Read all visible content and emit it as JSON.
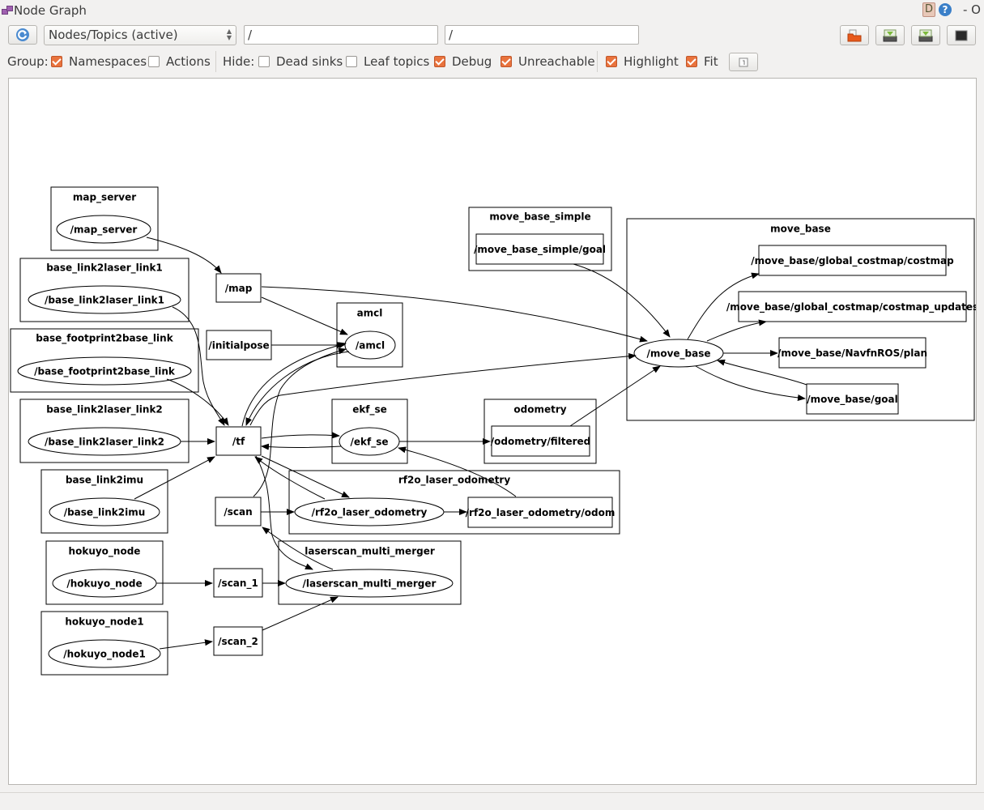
{
  "window": {
    "title": "Node Graph",
    "right_text": "- O",
    "d_label": "D",
    "help_label": "?"
  },
  "toolbar": {
    "refresh_icon": "refresh-icon",
    "graph_type": "Nodes/Topics (active)",
    "node_filter": "/",
    "topic_filter": "/",
    "right_buttons": [
      "open-icon",
      "save-dot-icon",
      "save-image-icon",
      "screenshot-icon"
    ]
  },
  "options": {
    "group_label": "Group:",
    "hide_label": "Hide:",
    "checkboxes": [
      {
        "label": "Namespaces",
        "checked": true
      },
      {
        "label": "Actions",
        "checked": false
      },
      {
        "label": "Dead sinks",
        "checked": false
      },
      {
        "label": "Leaf topics",
        "checked": false
      },
      {
        "label": "Debug",
        "checked": true
      },
      {
        "label": "Unreachable",
        "checked": true
      },
      {
        "label": "Highlight",
        "checked": true
      },
      {
        "label": "Fit",
        "checked": true
      }
    ],
    "fit_button_icon": "fit-view-icon"
  },
  "graph": {
    "clusters": [
      {
        "id": "c_map_server",
        "label": "map_server"
      },
      {
        "id": "c_bl2ll1",
        "label": "base_link2laser_link1"
      },
      {
        "id": "c_bf2bl",
        "label": "base_footprint2base_link"
      },
      {
        "id": "c_bl2ll2",
        "label": "base_link2laser_link2"
      },
      {
        "id": "c_bl2imu",
        "label": "base_link2imu"
      },
      {
        "id": "c_hokuyo",
        "label": "hokuyo_node"
      },
      {
        "id": "c_hokuyo1",
        "label": "hokuyo_node1"
      },
      {
        "id": "c_amcl",
        "label": "amcl"
      },
      {
        "id": "c_ekf",
        "label": "ekf_se"
      },
      {
        "id": "c_odometry",
        "label": "odometry"
      },
      {
        "id": "c_rf2o",
        "label": "rf2o_laser_odometry"
      },
      {
        "id": "c_lsmm",
        "label": "laserscan_multi_merger"
      },
      {
        "id": "c_mbs",
        "label": "move_base_simple"
      },
      {
        "id": "c_mb",
        "label": "move_base"
      }
    ],
    "nodes": [
      {
        "id": "n_map_server",
        "label": "/map_server",
        "kind": "node"
      },
      {
        "id": "n_bl2ll1",
        "label": "/base_link2laser_link1",
        "kind": "node"
      },
      {
        "id": "n_bf2bl",
        "label": "/base_footprint2base_link",
        "kind": "node"
      },
      {
        "id": "n_bl2ll2",
        "label": "/base_link2laser_link2",
        "kind": "node"
      },
      {
        "id": "n_bl2imu",
        "label": "/base_link2imu",
        "kind": "node"
      },
      {
        "id": "n_hokuyo",
        "label": "/hokuyo_node",
        "kind": "node"
      },
      {
        "id": "n_hokuyo1",
        "label": "/hokuyo_node1",
        "kind": "node"
      },
      {
        "id": "n_amcl",
        "label": "/amcl",
        "kind": "node"
      },
      {
        "id": "n_ekf",
        "label": "/ekf_se",
        "kind": "node"
      },
      {
        "id": "n_rf2o",
        "label": "/rf2o_laser_odometry",
        "kind": "node"
      },
      {
        "id": "n_lsmm",
        "label": "/laserscan_multi_merger",
        "kind": "node"
      },
      {
        "id": "n_mb",
        "label": "/move_base",
        "kind": "node"
      },
      {
        "id": "t_map",
        "label": "/map",
        "kind": "topic"
      },
      {
        "id": "t_initialpose",
        "label": "/initialpose",
        "kind": "topic"
      },
      {
        "id": "t_tf",
        "label": "/tf",
        "kind": "topic"
      },
      {
        "id": "t_scan",
        "label": "/scan",
        "kind": "topic"
      },
      {
        "id": "t_scan1",
        "label": "/scan_1",
        "kind": "topic"
      },
      {
        "id": "t_scan2",
        "label": "/scan_2",
        "kind": "topic"
      },
      {
        "id": "t_odom_filtered",
        "label": "/odometry/filtered",
        "kind": "topic"
      },
      {
        "id": "t_rf2o_odom",
        "label": "/rf2o_laser_odometry/odom",
        "kind": "topic"
      },
      {
        "id": "t_mbs_goal",
        "label": "/move_base_simple/goal",
        "kind": "topic"
      },
      {
        "id": "t_costmap",
        "label": "/move_base/global_costmap/costmap",
        "kind": "topic"
      },
      {
        "id": "t_costmap_updates",
        "label": "/move_base/global_costmap/costmap_updates",
        "kind": "topic"
      },
      {
        "id": "t_plan",
        "label": "/move_base/NavfnROS/plan",
        "kind": "topic"
      },
      {
        "id": "t_mb_goal",
        "label": "/move_base/goal",
        "kind": "topic"
      }
    ],
    "edges": [
      [
        "n_map_server",
        "t_map"
      ],
      [
        "n_bl2ll1",
        "t_tf"
      ],
      [
        "n_bf2bl",
        "t_tf"
      ],
      [
        "n_bl2ll2",
        "t_tf"
      ],
      [
        "n_bl2imu",
        "t_tf"
      ],
      [
        "n_hokuyo",
        "t_scan1"
      ],
      [
        "n_hokuyo1",
        "t_scan2"
      ],
      [
        "t_map",
        "n_amcl"
      ],
      [
        "t_map",
        "n_mb"
      ],
      [
        "t_initialpose",
        "n_amcl"
      ],
      [
        "t_tf",
        "n_amcl"
      ],
      [
        "n_amcl",
        "t_tf"
      ],
      [
        "t_scan",
        "n_amcl"
      ],
      [
        "t_tf",
        "n_ekf"
      ],
      [
        "n_ekf",
        "t_tf"
      ],
      [
        "n_ekf",
        "t_odom_filtered"
      ],
      [
        "t_tf",
        "n_mb"
      ],
      [
        "t_tf",
        "n_rf2o"
      ],
      [
        "n_rf2o",
        "t_tf"
      ],
      [
        "t_scan",
        "n_rf2o"
      ],
      [
        "n_rf2o",
        "t_rf2o_odom"
      ],
      [
        "t_rf2o_odom",
        "n_ekf"
      ],
      [
        "t_tf",
        "n_lsmm"
      ],
      [
        "n_lsmm",
        "t_scan"
      ],
      [
        "t_scan1",
        "n_lsmm"
      ],
      [
        "t_scan2",
        "n_lsmm"
      ],
      [
        "t_odom_filtered",
        "n_mb"
      ],
      [
        "t_mbs_goal",
        "n_mb"
      ],
      [
        "n_mb",
        "t_costmap"
      ],
      [
        "n_mb",
        "t_costmap_updates"
      ],
      [
        "n_mb",
        "t_plan"
      ],
      [
        "n_mb",
        "t_mb_goal"
      ],
      [
        "t_mb_goal",
        "n_mb"
      ]
    ]
  }
}
